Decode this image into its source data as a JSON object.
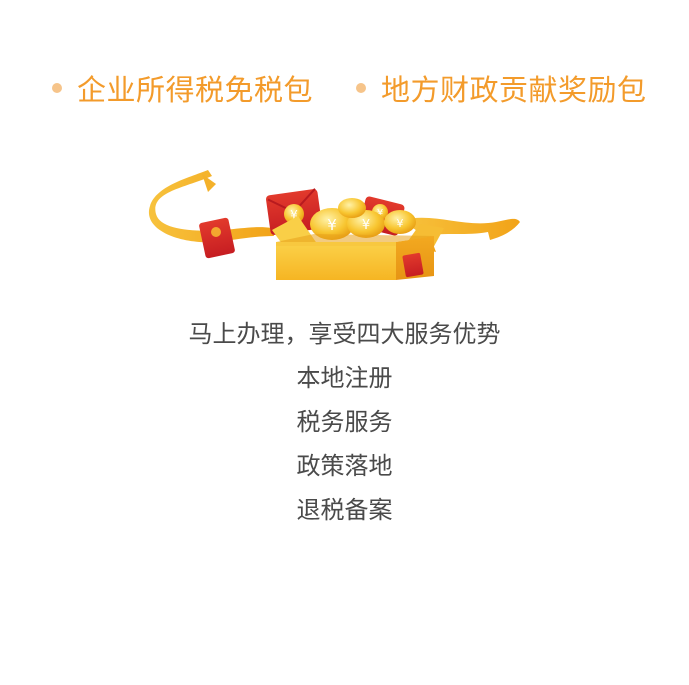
{
  "headlines": [
    {
      "text": "企业所得税免税包",
      "bullet_color": "#f6c48a",
      "text_color": "#f39b2b"
    },
    {
      "text": "地方财政贡献奖励包",
      "bullet_color": "#f6c48a",
      "text_color": "#f39b2b"
    }
  ],
  "illustration": {
    "icon": "gift-box-red-envelopes-coins-icon",
    "coin_symbol": "¥"
  },
  "info": {
    "lead": "马上办理，享受四大服务优势",
    "items": [
      "本地注册",
      "税务服务",
      "政策落地",
      "退税备案"
    ]
  }
}
